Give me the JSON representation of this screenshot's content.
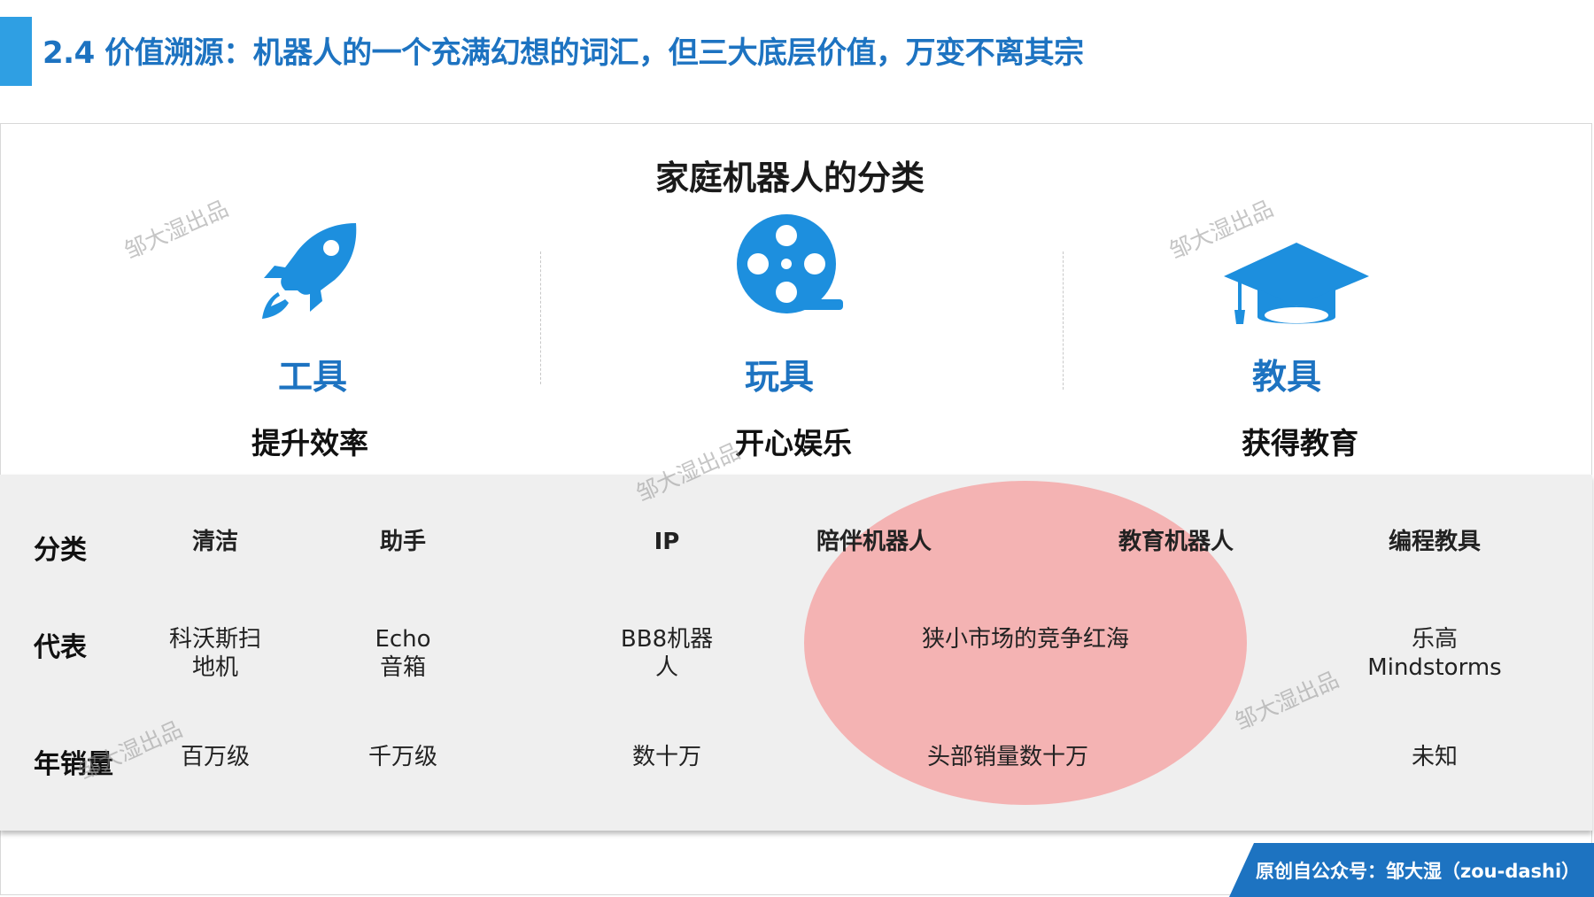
{
  "header": {
    "title": "2.4 价值溯源：机器人的一个充满幻想的词汇，但三大底层价值，万变不离其宗",
    "accent_color": "#2f9fe3",
    "title_color": "#1d73c1"
  },
  "diagram": {
    "title": "家庭机器人的分类",
    "categories": [
      {
        "icon": "rocket-icon",
        "name": "工具",
        "desc": "提升效率"
      },
      {
        "icon": "film-reel-icon",
        "name": "玩具",
        "desc": "开心娱乐"
      },
      {
        "icon": "graduation-cap-icon",
        "name": "教具",
        "desc": "获得教育"
      }
    ]
  },
  "table": {
    "row_labels": [
      "分类",
      "代表",
      "年销量"
    ],
    "columns": [
      {
        "header": "清洁",
        "rep": "科沃斯扫\n地机",
        "sales": "百万级"
      },
      {
        "header": "助手",
        "rep": "Echo\n音箱",
        "sales": "千万级"
      },
      {
        "header": "IP",
        "rep": "BB8机器\n人",
        "sales": "数十万"
      },
      {
        "header": "陪伴机器人",
        "rep": "",
        "sales": ""
      },
      {
        "header": "教育机器人",
        "rep": "",
        "sales": ""
      },
      {
        "header": "编程教具",
        "rep": "乐高\nMindstorms",
        "sales": "未知"
      }
    ],
    "highlight": {
      "rep": "狭小市场的竞争红海",
      "sales": "头部销量数十万",
      "color": "#f4b3b3"
    }
  },
  "watermark": "邹大湿出品",
  "footer": {
    "text": "原创自公众号：邹大湿（zou-dashi）",
    "color": "#1d73c1"
  }
}
